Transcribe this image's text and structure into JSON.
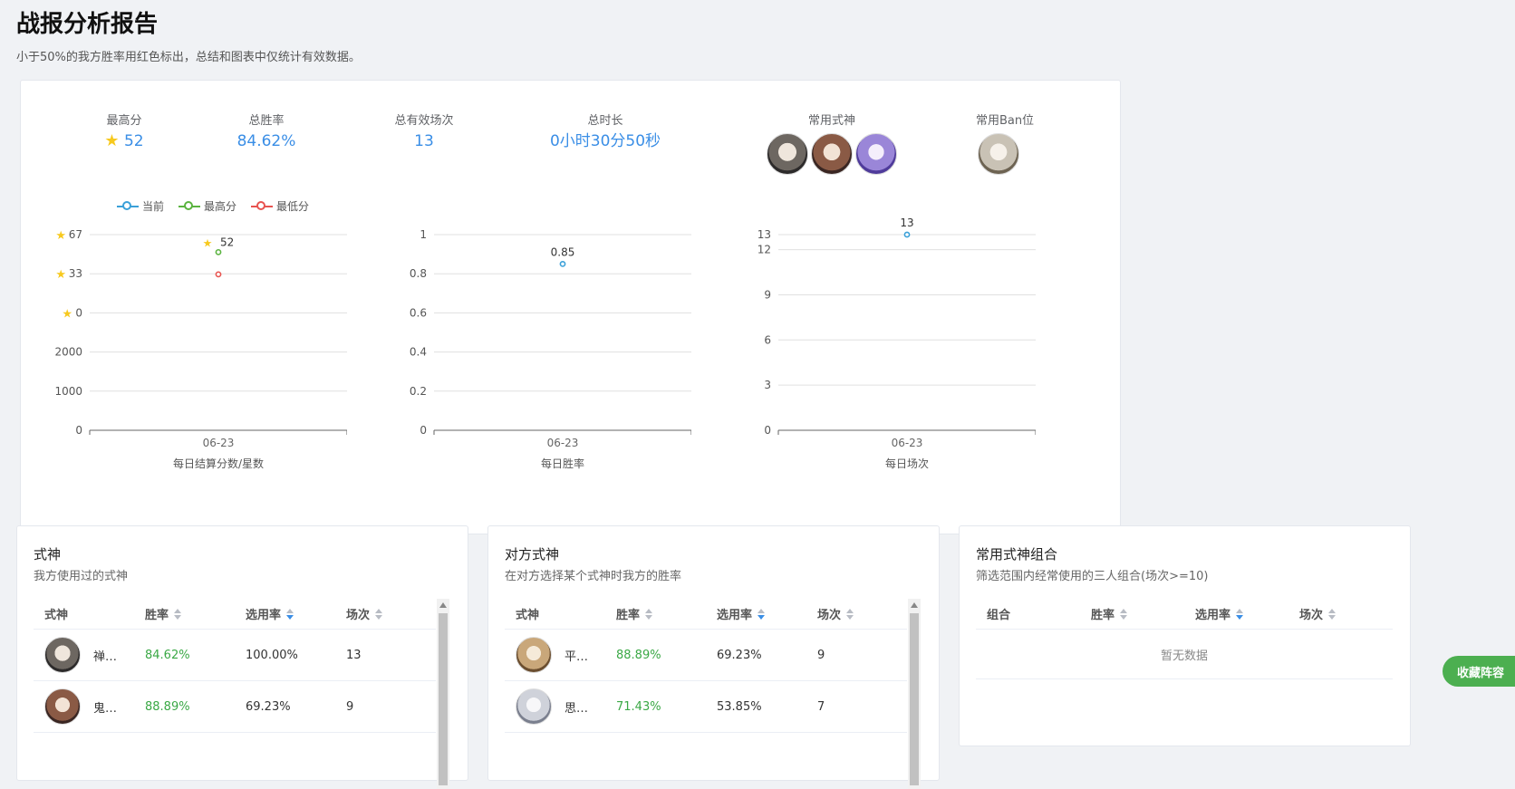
{
  "header": {
    "title": "战报分析报告",
    "subtitle": "小于50%的我方胜率用红色标出，总结和图表中仅统计有效数据。"
  },
  "summary": {
    "max_score": {
      "label": "最高分",
      "value": "52"
    },
    "win_rate": {
      "label": "总胜率",
      "value": "84.62%"
    },
    "valid_matches": {
      "label": "总有效场次",
      "value": "13"
    },
    "total_time": {
      "label": "总时长",
      "value": "0小时30分50秒"
    },
    "common_shikigami": {
      "label": "常用式神",
      "icons": [
        "shikigami-avatar-1",
        "shikigami-avatar-2",
        "shikigami-avatar-3"
      ]
    },
    "common_ban": {
      "label": "常用Ban位",
      "icons": [
        "ban-avatar-1"
      ]
    }
  },
  "legend": {
    "current": "当前",
    "max": "最高分",
    "min": "最低分"
  },
  "chart_data": [
    {
      "type": "scatter",
      "title": "每日结算分数/星数",
      "x": [
        "06-23"
      ],
      "y_tick_labels": [
        "67",
        "33",
        "0",
        "2000",
        "1000",
        "0"
      ],
      "series": [
        {
          "name": "最高分",
          "values": [
            52
          ]
        },
        {
          "name": "最低分",
          "values": [
            33
          ]
        }
      ],
      "data_labels": [
        "52"
      ],
      "colors": {
        "当前": "#3aa0d8",
        "最高分": "#5ab33f",
        "最低分": "#e8534f"
      }
    },
    {
      "type": "scatter",
      "title": "每日胜率",
      "x": [
        "06-23"
      ],
      "ylim": [
        0,
        1
      ],
      "y_ticks": [
        "0",
        "0.2",
        "0.4",
        "0.6",
        "0.8",
        "1"
      ],
      "series": [
        {
          "name": "当前",
          "values": [
            0.85
          ]
        }
      ],
      "data_labels": [
        "0.85"
      ]
    },
    {
      "type": "scatter",
      "title": "每日场次",
      "x": [
        "06-23"
      ],
      "ylim": [
        0,
        13
      ],
      "y_ticks": [
        "0",
        "3",
        "6",
        "9",
        "12",
        "13"
      ],
      "series": [
        {
          "name": "当前",
          "values": [
            13
          ]
        }
      ],
      "data_labels": [
        "13"
      ]
    }
  ],
  "panels": {
    "my_shikigami": {
      "title": "式神",
      "subtitle": "我方使用过的式神",
      "columns": [
        "式神",
        "胜率",
        "选用率",
        "场次"
      ],
      "rows": [
        {
          "name": "禅…",
          "win": "84.62%",
          "pick": "100.00%",
          "count": "13"
        },
        {
          "name": "鬼…",
          "win": "88.89%",
          "pick": "69.23%",
          "count": "9"
        }
      ]
    },
    "enemy_shikigami": {
      "title": "对方式神",
      "subtitle": "在对方选择某个式神时我方的胜率",
      "columns": [
        "式神",
        "胜率",
        "选用率",
        "场次"
      ],
      "rows": [
        {
          "name": "平…",
          "win": "88.89%",
          "pick": "69.23%",
          "count": "9"
        },
        {
          "name": "思…",
          "win": "71.43%",
          "pick": "53.85%",
          "count": "7"
        }
      ]
    },
    "combos": {
      "title": "常用式神组合",
      "subtitle": "筛选范围内经常使用的三人组合(场次>=10)",
      "columns": [
        "组合",
        "胜率",
        "选用率",
        "场次"
      ],
      "empty": "暂无数据"
    }
  },
  "fav_button": "收藏阵容",
  "colors": {
    "accent": "#3a8ee6",
    "win": "#3aa845",
    "star": "#f7c91e",
    "button": "#4caf50"
  }
}
